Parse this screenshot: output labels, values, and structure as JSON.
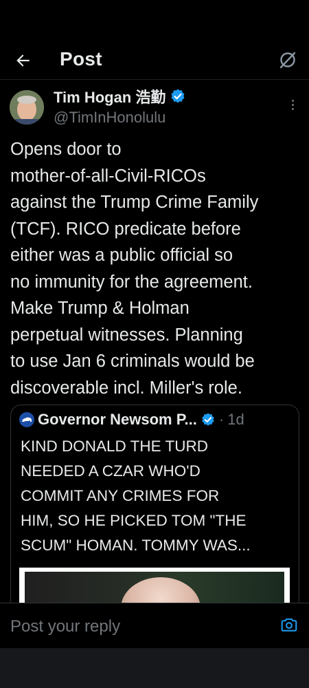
{
  "header": {
    "title": "Post"
  },
  "author": {
    "name": "Tim Hogan 浩勤",
    "handle": "@TimInHonolulu"
  },
  "tweet": {
    "text": "Opens door to\nmother-of-all-Civil-RICOs\nagainst the Trump Crime Family\n(TCF).  RICO predicate before\neither was a public official so\nno immunity for the agreement.\nMake Trump & Holman\nperpetual witnesses.  Planning\nto use Jan 6 criminals would be\ndiscoverable incl. Miller's role."
  },
  "quote": {
    "name": "Governor Newsom P...",
    "separator": "·",
    "time": "1d",
    "text": "KIND DONALD THE TURD\nNEEDED A CZAR WHO'D\nCOMMIT ANY CRIMES FOR\nHIM, SO HE PICKED TOM \"THE\nSCUM\" HOMAN. TOMMY WAS..."
  },
  "reply": {
    "placeholder": "Post your reply"
  },
  "colors": {
    "accent": "#1d9bf0",
    "background": "#000000",
    "muted": "#71767b",
    "text": "#e7e9ea"
  },
  "icons": {
    "back": "arrow-left-icon",
    "grok": "grok-icon",
    "verified": "verified-badge-icon",
    "more": "more-vertical-icon",
    "camera": "camera-icon"
  }
}
